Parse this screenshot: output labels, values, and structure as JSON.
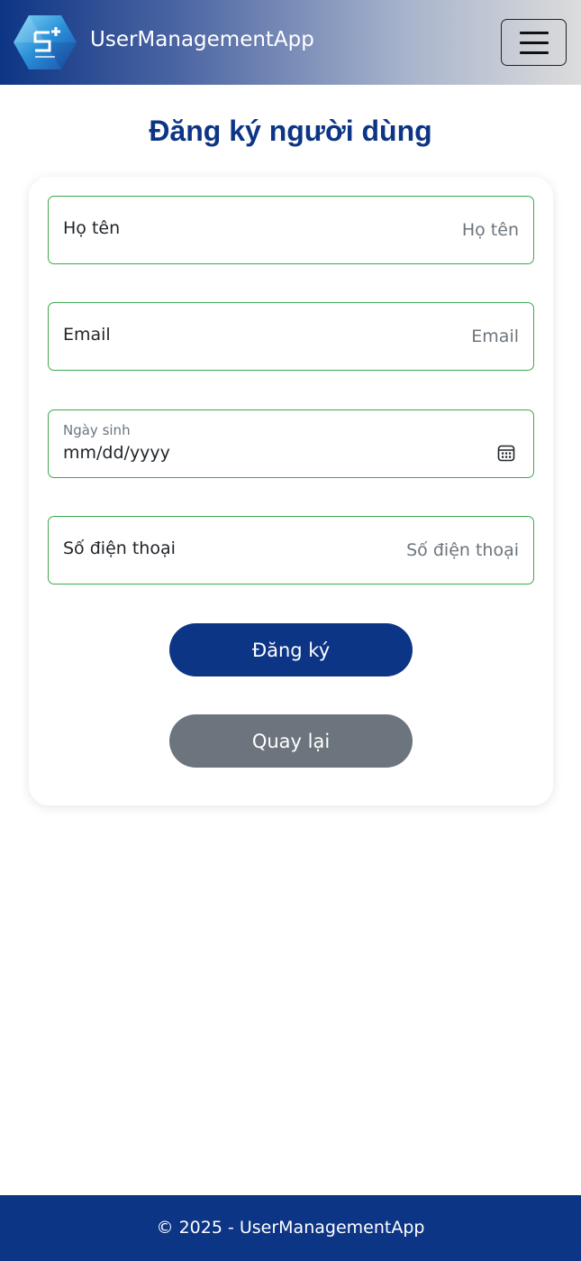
{
  "navbar": {
    "brand": "UserManagementApp",
    "logo_icon": "cube-logo-icon",
    "menu_icon": "hamburger-icon"
  },
  "page": {
    "title": "Đăng ký người dùng"
  },
  "form": {
    "full_name": {
      "label": "Họ tên",
      "placeholder": "Họ tên"
    },
    "email": {
      "label": "Email",
      "placeholder": "Email"
    },
    "birth_date": {
      "label": "Ngày sinh",
      "value": "mm/dd/yyyy",
      "icon": "calendar-icon"
    },
    "phone": {
      "label": "Số điện thoại",
      "placeholder": "Số điện thoại"
    },
    "submit_label": "Đăng ký",
    "back_label": "Quay lại"
  },
  "footer": {
    "text": "© 2025 - UserManagementApp"
  },
  "colors": {
    "primary": "#0d3585",
    "secondary": "#6c757d",
    "field_border": "#3ea84f"
  }
}
